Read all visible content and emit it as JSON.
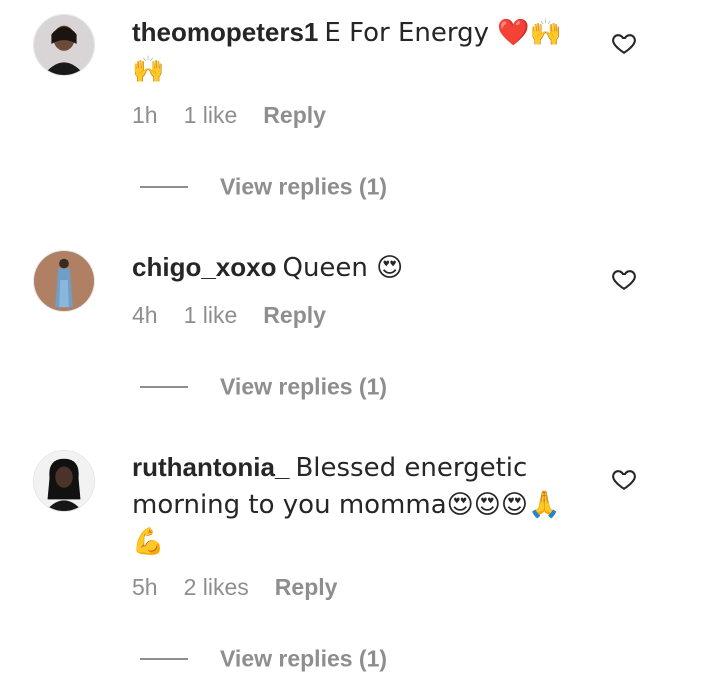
{
  "comments": [
    {
      "username": "theomopeters1",
      "text": "E For Energy ❤️🙌",
      "text_line2": "🙌",
      "time": "1h",
      "likes": "1 like",
      "reply_label": "Reply",
      "view_replies": "View replies (1)"
    },
    {
      "username": "chigo_xoxo",
      "text": "Queen 😍",
      "time": "4h",
      "likes": "1 like",
      "reply_label": "Reply",
      "view_replies": "View replies (1)"
    },
    {
      "username": "ruthantonia_",
      "text": "Blessed energetic",
      "text_line2": "morning to you momma😍😍😍🙏",
      "text_line3": "💪",
      "time": "5h",
      "likes": "2 likes",
      "reply_label": "Reply",
      "view_replies": "View replies (1)"
    }
  ],
  "icons": {
    "like": "heart-outline-icon"
  }
}
